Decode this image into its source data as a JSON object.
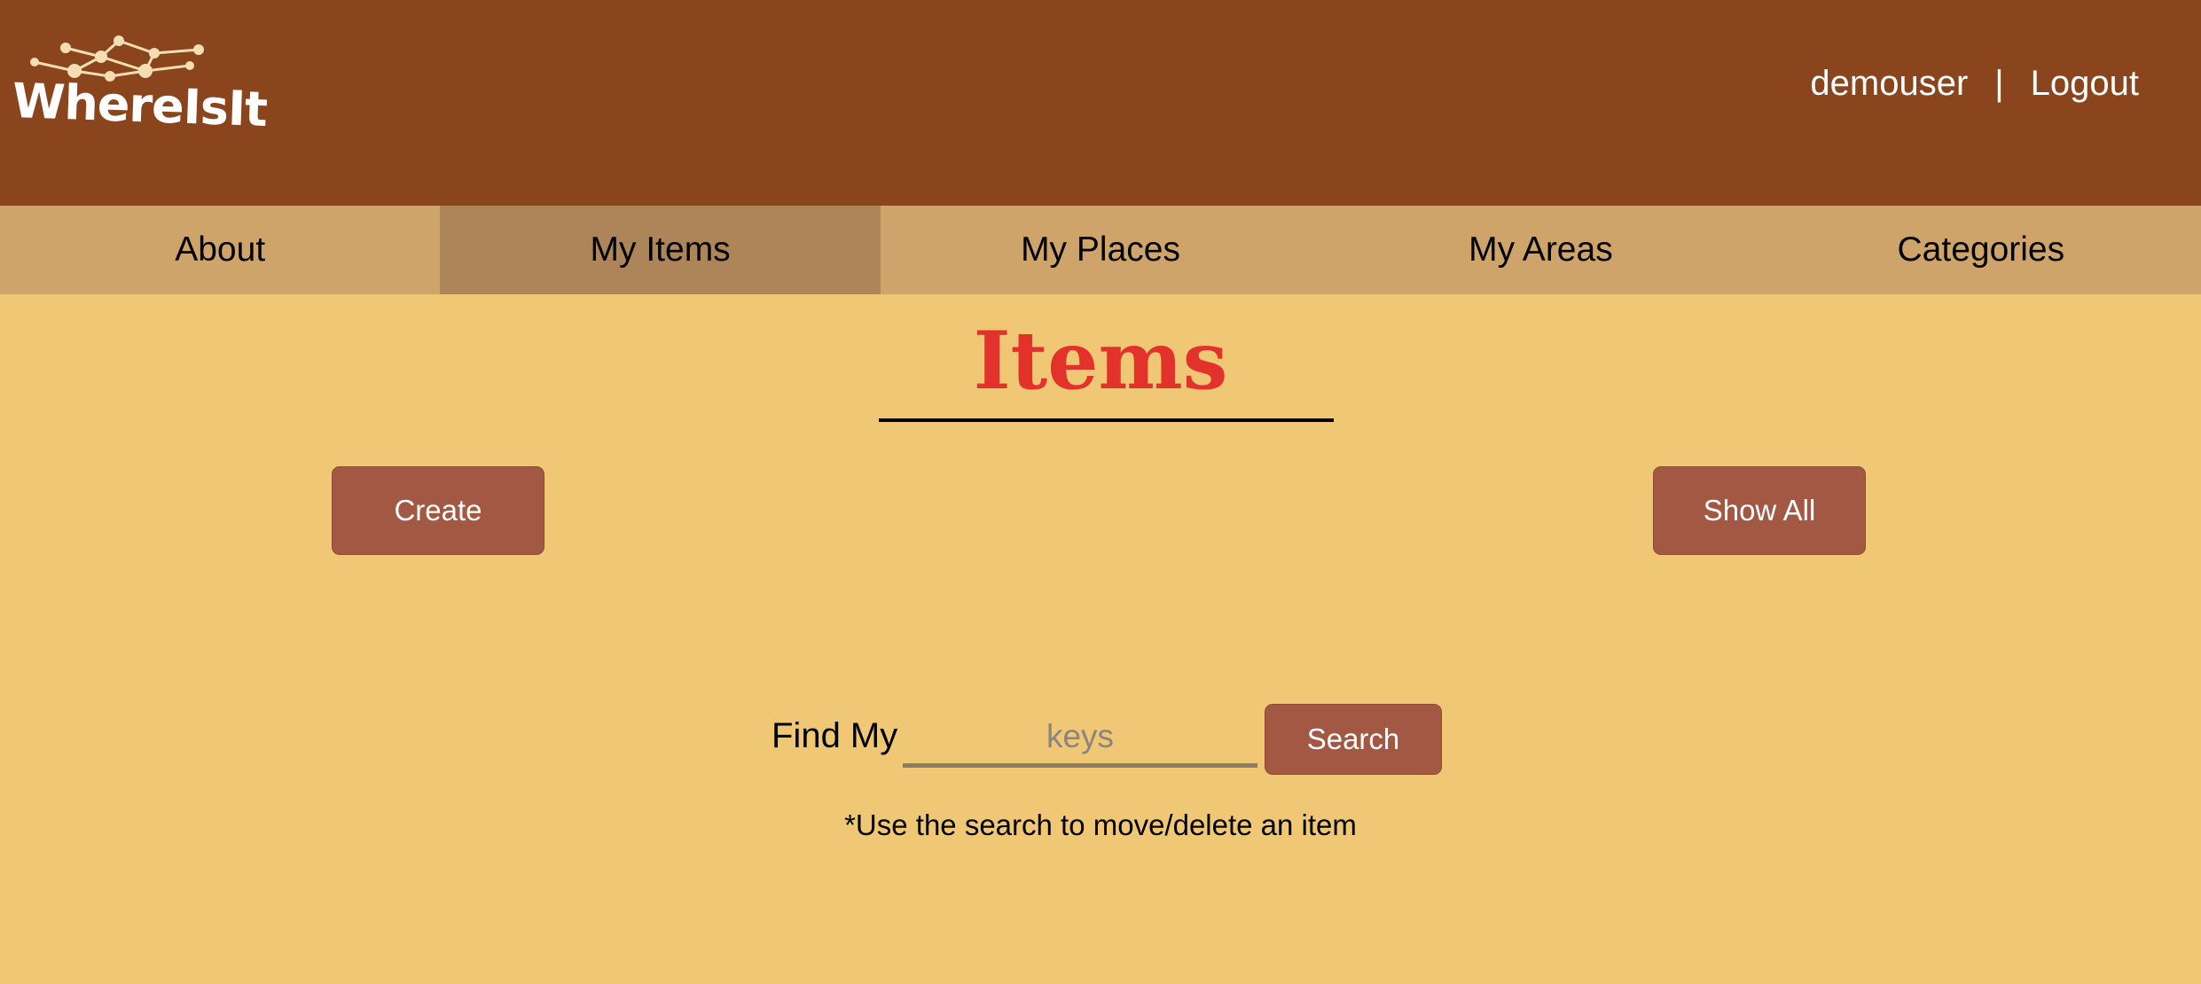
{
  "brand": {
    "name": "WhereIsIt"
  },
  "header": {
    "username": "demouser",
    "separator": "|",
    "logout_label": "Logout"
  },
  "nav": {
    "items": [
      {
        "label": "About"
      },
      {
        "label": "My Items"
      },
      {
        "label": "My Places"
      },
      {
        "label": "My Areas"
      },
      {
        "label": "Categories"
      }
    ],
    "active": "My Items"
  },
  "main": {
    "title": "Items",
    "create_label": "Create",
    "show_all_label": "Show All",
    "find_label": "Find My",
    "search_placeholder": "keys",
    "search_value": "",
    "search_button_label": "Search",
    "hint": "*Use the search to move/delete an item"
  },
  "colors": {
    "header_bg": "#8b451d",
    "nav_bg": "#cfa46a",
    "nav_active_bg": "#ad8558",
    "page_bg": "#f0c875",
    "title_color": "#e3322b",
    "button_bg": "#a25842"
  }
}
